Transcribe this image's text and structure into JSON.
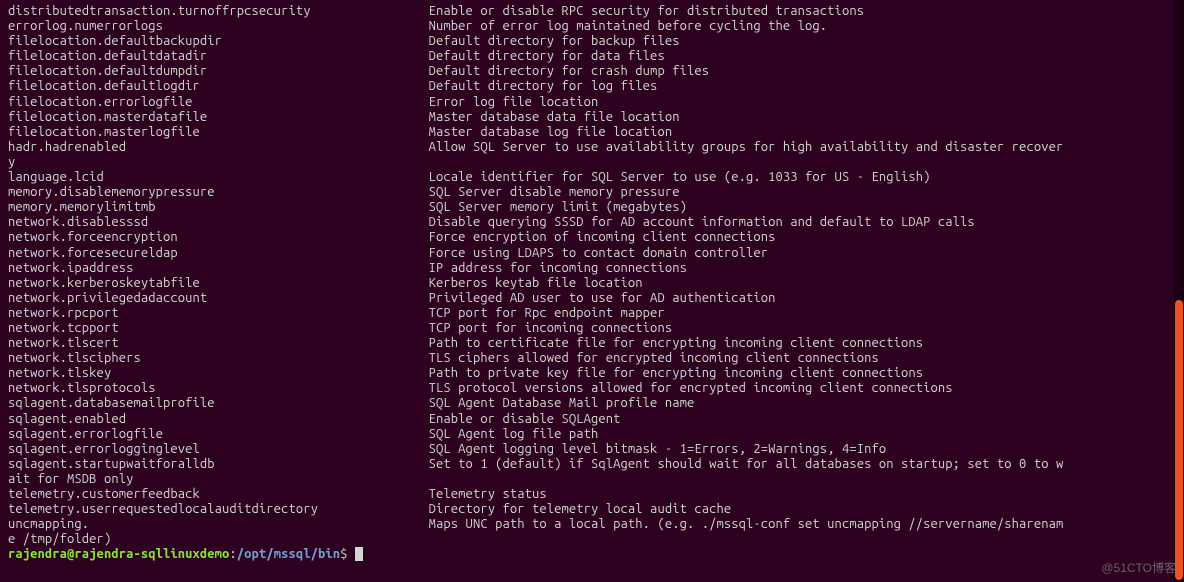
{
  "keycol_width": 57,
  "rows": [
    {
      "key": "distributedtransaction.turnoffrpcsecurity",
      "desc": "Enable or disable RPC security for distributed transactions"
    },
    {
      "key": "errorlog.numerrorlogs",
      "desc": "Number of error log maintained before cycling the log."
    },
    {
      "key": "filelocation.defaultbackupdir",
      "desc": "Default directory for backup files"
    },
    {
      "key": "filelocation.defaultdatadir",
      "desc": "Default directory for data files"
    },
    {
      "key": "filelocation.defaultdumpdir",
      "desc": "Default directory for crash dump files"
    },
    {
      "key": "filelocation.defaultlogdir",
      "desc": "Default directory for log files"
    },
    {
      "key": "filelocation.errorlogfile",
      "desc": "Error log file location"
    },
    {
      "key": "filelocation.masterdatafile",
      "desc": "Master database data file location"
    },
    {
      "key": "filelocation.masterlogfile",
      "desc": "Master database log file location"
    },
    {
      "key": "hadr.hadrenabled",
      "desc": "Allow SQL Server to use availability groups for high availability and disaster recover"
    },
    {
      "wrap": "y"
    },
    {
      "key": "language.lcid",
      "desc": "Locale identifier for SQL Server to use (e.g. 1033 for US - English)"
    },
    {
      "key": "memory.disablememorypressure",
      "desc": "SQL Server disable memory pressure"
    },
    {
      "key": "memory.memorylimitmb",
      "desc": "SQL Server memory limit (megabytes)"
    },
    {
      "key": "network.disablesssd",
      "desc": "Disable querying SSSD for AD account information and default to LDAP calls"
    },
    {
      "key": "network.forceencryption",
      "desc": "Force encryption of incoming client connections"
    },
    {
      "key": "network.forcesecureldap",
      "desc": "Force using LDAPS to contact domain controller"
    },
    {
      "key": "network.ipaddress",
      "desc": "IP address for incoming connections"
    },
    {
      "key": "network.kerberoskeytabfile",
      "desc": "Kerberos keytab file location"
    },
    {
      "key": "network.privilegedadaccount",
      "desc": "Privileged AD user to use for AD authentication"
    },
    {
      "key": "network.rpcport",
      "desc": "TCP port for Rpc endpoint mapper"
    },
    {
      "key": "network.tcpport",
      "desc": "TCP port for incoming connections"
    },
    {
      "key": "network.tlscert",
      "desc": "Path to certificate file for encrypting incoming client connections"
    },
    {
      "key": "network.tlsciphers",
      "desc": "TLS ciphers allowed for encrypted incoming client connections"
    },
    {
      "key": "network.tlskey",
      "desc": "Path to private key file for encrypting incoming client connections"
    },
    {
      "key": "network.tlsprotocols",
      "desc": "TLS protocol versions allowed for encrypted incoming client connections"
    },
    {
      "key": "sqlagent.databasemailprofile",
      "desc": "SQL Agent Database Mail profile name"
    },
    {
      "key": "sqlagent.enabled",
      "desc": "Enable or disable SQLAgent"
    },
    {
      "key": "sqlagent.errorlogfile",
      "desc": "SQL Agent log file path"
    },
    {
      "key": "sqlagent.errorlogginglevel",
      "desc": "SQL Agent logging level bitmask - 1=Errors, 2=Warnings, 4=Info"
    },
    {
      "key": "sqlagent.startupwaitforalldb",
      "desc": "Set to 1 (default) if SqlAgent should wait for all databases on startup; set to 0 to w"
    },
    {
      "wrap": "ait for MSDB only"
    },
    {
      "key": "telemetry.customerfeedback",
      "desc": "Telemetry status"
    },
    {
      "key": "telemetry.userrequestedlocalauditdirectory",
      "desc": "Directory for telemetry local audit cache"
    },
    {
      "key": "uncmapping.",
      "desc": "Maps UNC path to a local path. (e.g. ./mssql-conf set uncmapping //servername/sharenam"
    },
    {
      "wrap": "e /tmp/folder)"
    }
  ],
  "prompt": {
    "user": "rajendra@rajendra-sqllinuxdemo",
    "sep": ":",
    "path": "/opt/mssql/bin",
    "dollar": "$"
  },
  "watermark": "@51CTO博客"
}
